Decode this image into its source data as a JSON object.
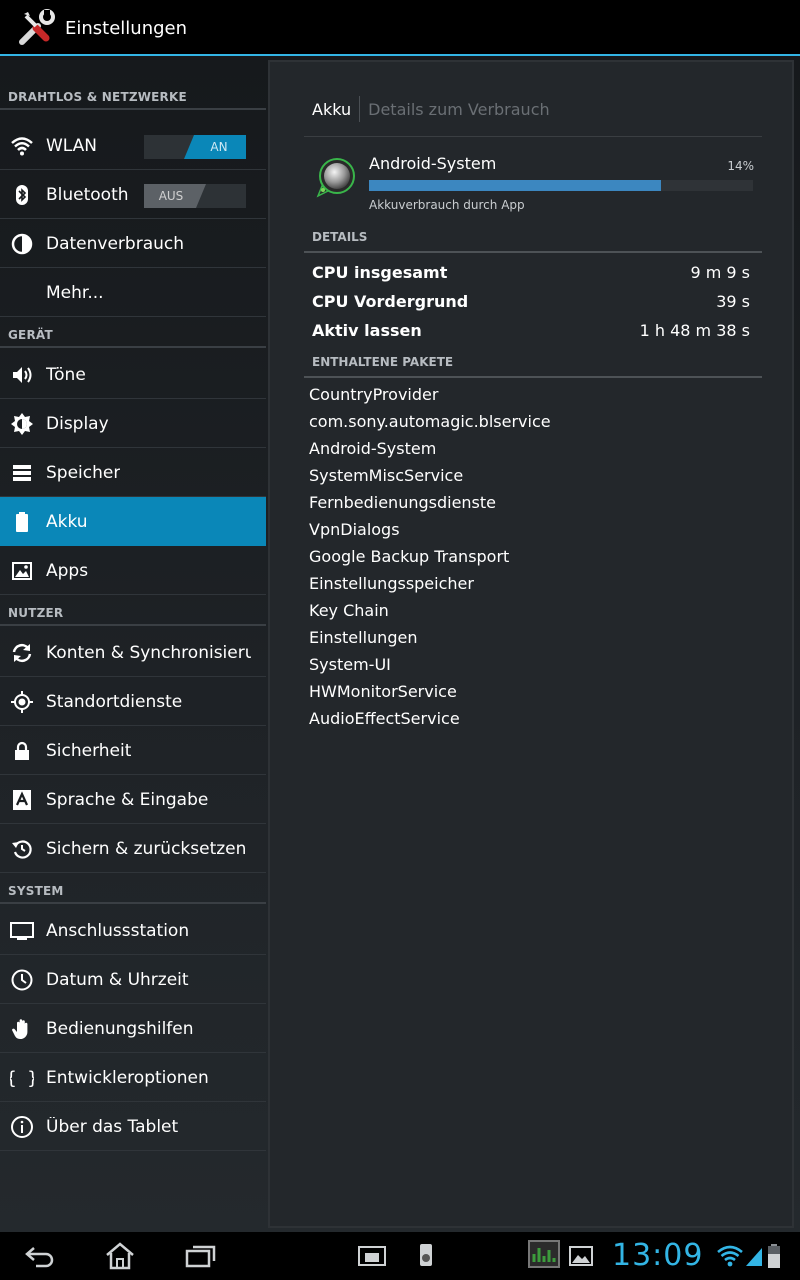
{
  "actionbar": {
    "title": "Einstellungen",
    "icon": "settings-tools-icon"
  },
  "sidebar": {
    "categories": [
      "DRAHTLOS & NETZWERKE",
      "GERÄT",
      "NUTZER",
      "SYSTEM"
    ],
    "items": [
      {
        "label": "WLAN",
        "icon": "wifi-icon"
      },
      {
        "label": "Bluetooth",
        "icon": "bluetooth-icon"
      },
      {
        "label": "Datenverbrauch",
        "icon": "data-usage-icon"
      },
      {
        "label": "Mehr...",
        "icon": ""
      },
      {
        "label": "Töne",
        "icon": "sound-icon"
      },
      {
        "label": "Display",
        "icon": "brightness-icon"
      },
      {
        "label": "Speicher",
        "icon": "storage-icon"
      },
      {
        "label": "Akku",
        "icon": "battery-icon",
        "active": true
      },
      {
        "label": "Apps",
        "icon": "apps-icon"
      },
      {
        "label": "Konten & Synchronisierung",
        "icon": "sync-icon"
      },
      {
        "label": "Standortdienste",
        "icon": "location-icon"
      },
      {
        "label": "Sicherheit",
        "icon": "lock-icon"
      },
      {
        "label": "Sprache & Eingabe",
        "icon": "language-icon"
      },
      {
        "label": "Sichern & zurücksetzen",
        "icon": "backup-icon"
      },
      {
        "label": "Anschlussstation",
        "icon": "dock-icon"
      },
      {
        "label": "Datum & Uhrzeit",
        "icon": "clock-icon"
      },
      {
        "label": "Bedienungshilfen",
        "icon": "accessibility-hand-icon"
      },
      {
        "label": "Entwickleroptionen",
        "icon": "developer-braces-icon"
      },
      {
        "label": "Über das Tablet",
        "icon": "info-icon"
      }
    ],
    "wlan_toggle": "AN",
    "bluetooth_toggle": "AUS"
  },
  "detail": {
    "breadcrumb_parent": "Akku",
    "breadcrumb_current": "Details zum Verbrauch",
    "app_name": "Android-System",
    "app_percent": "14%",
    "app_percent_value": 0.76,
    "app_subtitle": "Akkuverbrauch durch App",
    "details_header": "DETAILS",
    "stats": [
      {
        "label": "CPU insgesamt",
        "value": "9 m 9 s"
      },
      {
        "label": "CPU Vordergrund",
        "value": "39 s"
      },
      {
        "label": "Aktiv lassen",
        "value": "1 h 48 m 38 s"
      }
    ],
    "packages_header": "ENTHALTENE PAKETE",
    "packages": [
      "CountryProvider",
      "com.sony.automagic.blservice",
      "Android-System",
      "SystemMiscService",
      "Fernbedienungsdienste",
      "VpnDialogs",
      "Google Backup Transport",
      "Einstellungsspeicher",
      "Key Chain",
      "Einstellungen",
      "System-UI",
      "HWMonitorService",
      "AudioEffectService"
    ]
  },
  "navbar": {
    "clock": "13:09"
  },
  "colors": {
    "accent": "#33b5e5",
    "selected": "#0a87b8",
    "bar_fill": "#3c87c0"
  }
}
